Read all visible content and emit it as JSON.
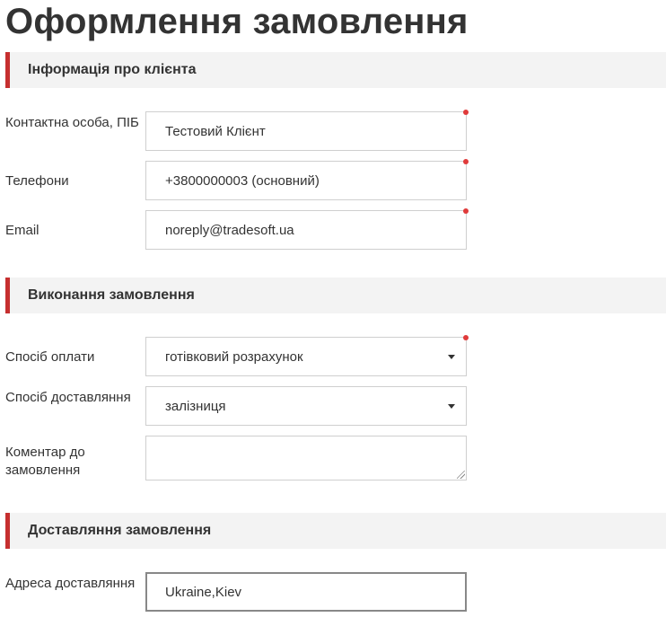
{
  "page": {
    "title": "Оформлення замовлення"
  },
  "sections": {
    "client_info": {
      "title": "Інформація про клієнта",
      "fields": {
        "contact_person": {
          "label": "Контактна особа, ПІБ",
          "value": "Тестовий Клієнт",
          "required": true
        },
        "phones": {
          "label": "Телефони",
          "value": "+3800000003 (основний)",
          "required": true
        },
        "email": {
          "label": "Email",
          "value": "noreply@tradesoft.ua",
          "required": true
        }
      }
    },
    "order_execution": {
      "title": "Виконання замовлення",
      "fields": {
        "payment_method": {
          "label": "Спосіб оплати",
          "value": "готівковий розрахунок",
          "required": true
        },
        "delivery_method": {
          "label": "Спосіб доставляння",
          "value": "залізниця"
        },
        "comment": {
          "label": "Коментар до замовлення",
          "value": ""
        }
      }
    },
    "delivery": {
      "title": "Доставляння замовлення",
      "fields": {
        "address": {
          "label": "Адреса доставляння",
          "value": "Ukraine,Kiev"
        }
      }
    }
  },
  "colors": {
    "accent": "#c62f2f",
    "required_marker": "#e03a3a",
    "section_bg": "#f3f3f3"
  }
}
